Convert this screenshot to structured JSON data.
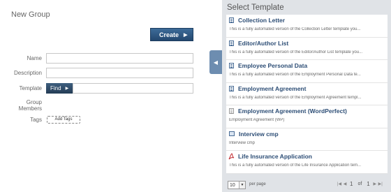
{
  "form": {
    "title": "New Group",
    "create_label": "Create",
    "labels": {
      "name": "Name",
      "description": "Description",
      "template": "Template",
      "group_members": [
        "Group",
        "Members"
      ],
      "tags": "Tags"
    },
    "find_label": "Find",
    "add_tags_label": "Add Tags"
  },
  "panel": {
    "title": "Select Template",
    "templates": [
      {
        "name": "Collection Letter",
        "desc": "This is a fully automated version of the Collection Letter template you...",
        "icon": "document-icon"
      },
      {
        "name": "Editor/Author List",
        "desc": "This is a fully automated version of the Editor/Author List template you...",
        "icon": "document-icon"
      },
      {
        "name": "Employee Personal Data",
        "desc": "This is a fully automated version of the Employment Personal Data te...",
        "icon": "document-icon"
      },
      {
        "name": "Employment Agreement",
        "desc": "This is a fully automated version of the Employment Agreement templ...",
        "icon": "document-icon"
      },
      {
        "name": "Employment Agreement (WordPerfect)",
        "desc": "Employment Agreement (WP)",
        "icon": "wordperfect-document-icon"
      },
      {
        "name": "Interview cmp",
        "desc": "Interview cmp",
        "icon": "form-icon"
      },
      {
        "name": "Life Insurance Application",
        "desc": "This is a fully automated version of the Life Insurance Application tem...",
        "icon": "pdf-icon"
      }
    ],
    "footer": {
      "per_page_value": "10",
      "per_page_label": "per page",
      "current_page": "1",
      "of_label": "of",
      "total_pages": "1"
    }
  }
}
